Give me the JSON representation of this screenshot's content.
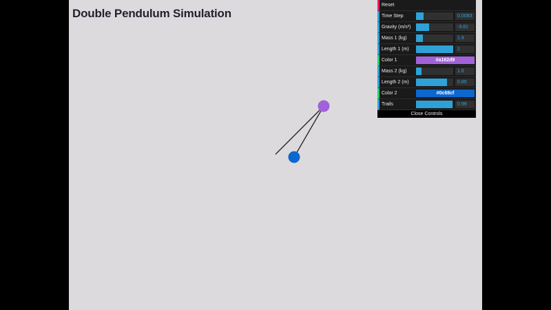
{
  "page": {
    "title": "Double Pendulum Simulation",
    "background": "#dcdadd",
    "letterbox": "#000000"
  },
  "pendulum": {
    "arm_color": "#222222",
    "bob1_color": "#a162d9",
    "bob2_color": "#0c68cf"
  },
  "controls": {
    "reset_label": "Reset",
    "close_label": "Close Controls",
    "accent": "#2fa1d6",
    "rows": [
      {
        "key": "time_step",
        "label": "Time Step",
        "value": "0.0083",
        "fill": 0.2
      },
      {
        "key": "gravity",
        "label": "Gravity (m/s²)",
        "value": "-9.81",
        "fill": 0.35
      },
      {
        "key": "mass1",
        "label": "Mass 1 (kg)",
        "value": "1.9",
        "fill": 0.18
      },
      {
        "key": "length1",
        "label": "Length 1 (m)",
        "value": "1",
        "fill": 1.0
      },
      {
        "key": "color1",
        "label": "Color 1",
        "color": "#a162d9"
      },
      {
        "key": "mass2",
        "label": "Mass 2 (kg)",
        "value": "1.6",
        "fill": 0.15
      },
      {
        "key": "length2",
        "label": "Length 2 (m)",
        "value": "0.85",
        "fill": 0.83
      },
      {
        "key": "color2",
        "label": "Color 2",
        "color": "#0c68cf"
      },
      {
        "key": "trails",
        "label": "Trails",
        "value": "0.99",
        "fill": 0.99
      }
    ]
  }
}
